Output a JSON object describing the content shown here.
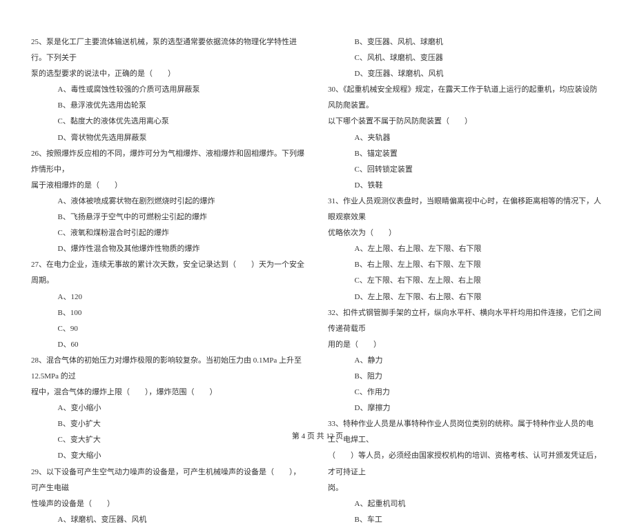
{
  "left": {
    "q25": {
      "stem1": "25、泵是化工厂主要流体输送机械，泵的选型通常要依据流体的物理化学特性进行。下列关于",
      "stem2": "泵的选型要求的说法中，正确的是（　　）",
      "a": "A、毒性或腐蚀性较强的介质可选用屏蔽泵",
      "b": "B、悬浮液优先选用齿轮泵",
      "c": "C、黏度大的液体优先选用离心泵",
      "d": "D、膏状物优先选用屏蔽泵"
    },
    "q26": {
      "stem1": "26、按照爆炸反应相的不同，爆炸可分为气相爆炸、液相爆炸和固相爆炸。下列爆炸情形中，",
      "stem2": "属于液相爆炸的是（　　）",
      "a": "A、液体被喷成雾状物在剧烈燃烧时引起的爆炸",
      "b": "B、飞扬悬浮于空气中的可燃粉尘引起的爆炸",
      "c": "C、液氧和煤粉混合时引起的爆炸",
      "d": "D、爆炸性混合物及其他爆炸性物质的爆炸"
    },
    "q27": {
      "stem1": "27、在电力企业，连续无事故的累计次天数，安全记录达到（　　）天为一个安全周期。",
      "a": "A、120",
      "b": "B、100",
      "c": "C、90",
      "d": "D、60"
    },
    "q28": {
      "stem1": "28、混合气体的初始压力对爆炸极限的影响较复杂。当初始压力由 0.1MPa 上升至 12.5MPa 的过",
      "stem2": "程中，混合气体的爆炸上限（　　），爆炸范围（　　）",
      "a": "A、变小缩小",
      "b": "B、变小扩大",
      "c": "C、变大扩大",
      "d": "D、变大缩小"
    },
    "q29": {
      "stem1": "29、以下设备可产生空气动力噪声的设备是，可产生机械噪声的设备是（　　），可产生电磁",
      "stem2": "性噪声的设备是（　　）",
      "a": "A、球磨机、变压器、风机"
    }
  },
  "right": {
    "q29opts": {
      "b": "B、变压器、风机、球磨机",
      "c": "C、风机、球磨机、变压器",
      "d": "D、变压器、球磨机、风机"
    },
    "q30": {
      "stem1": "30、《起重机械安全规程》规定，在露天工作于轨道上运行的起重机，均应装设防风防爬装置。",
      "stem2": "以下哪个装置不属于防风防爬装置（　　）",
      "a": "A、夹轨器",
      "b": "B、锚定装置",
      "c": "C、回转锁定装置",
      "d": "D、铁鞋"
    },
    "q31": {
      "stem1": "31、作业人员观测仪表盘时，当眼睛偏离视中心时，在偏移距离相等的情况下，人眼观察效果",
      "stem2": "优略依次为（　　）",
      "a": "A、左上限、右上限、左下限、右下限",
      "b": "B、右上限、左上限、右下限、左下限",
      "c": "C、左下限、右下限、左上限、右上限",
      "d": "D、左上限、左下限、右上限、右下限"
    },
    "q32": {
      "stem1": "32、扣件式钢管脚手架的立杆，纵向水平杆、横向水平杆均用扣件连接，它们之间传递荷载币",
      "stem2": "用的是（　　）",
      "a": "A、静力",
      "b": "B、阻力",
      "c": "C、作用力",
      "d": "D、摩擦力"
    },
    "q33": {
      "stem1": "33、特种作业人员是从事特种作业人员岗位类别的统称。属于特种作业人员的电工、电焊工、",
      "stem2": "（　　）等人员，必须经由国家授权机构的培训、资格考核、认可并颁发凭证后，才可持证上",
      "stem3": "岗。",
      "a": "A、起重机司机",
      "b": "B、车工"
    }
  },
  "footer": "第 4 页 共 12 页"
}
